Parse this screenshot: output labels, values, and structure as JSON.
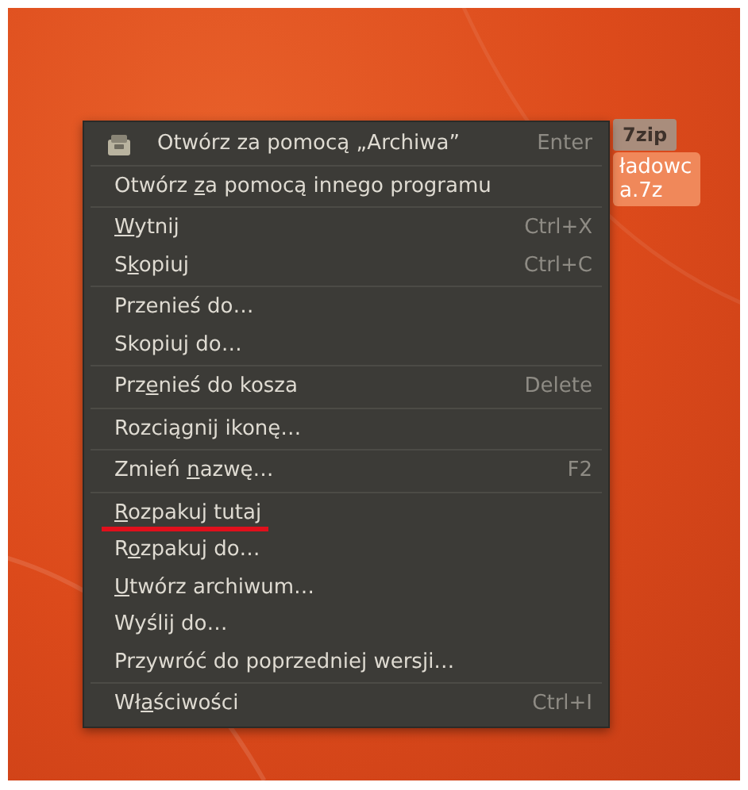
{
  "desktop_icon": {
    "icon_text": "7zip",
    "label_lines": [
      "ładowc",
      "a.7z"
    ],
    "selected": true
  },
  "menu": {
    "groups": [
      {
        "items": [
          {
            "kind": "app",
            "label_parts": [
              {
                "text": "Otwórz za pomocą „Archiwa”",
                "underlined": false
              }
            ],
            "shortcut": "Enter",
            "highlighted": false
          }
        ]
      },
      {
        "items": [
          {
            "kind": "plain",
            "label_parts": [
              {
                "text": "Otwórz ",
                "underlined": false
              },
              {
                "text": "z",
                "underlined": true
              },
              {
                "text": "a pomocą innego programu",
                "underlined": false
              }
            ],
            "highlighted": false
          }
        ]
      },
      {
        "items": [
          {
            "kind": "plain",
            "label_parts": [
              {
                "text": "W",
                "underlined": true
              },
              {
                "text": "ytnij",
                "underlined": false
              }
            ],
            "shortcut": "Ctrl+X",
            "highlighted": false
          },
          {
            "kind": "plain",
            "label_parts": [
              {
                "text": "S",
                "underlined": false
              },
              {
                "text": "k",
                "underlined": true
              },
              {
                "text": "opiuj",
                "underlined": false
              }
            ],
            "shortcut": "Ctrl+C",
            "highlighted": false
          }
        ]
      },
      {
        "items": [
          {
            "kind": "plain",
            "label_parts": [
              {
                "text": "Przenieś do…",
                "underlined": false
              }
            ],
            "highlighted": false
          },
          {
            "kind": "plain",
            "label_parts": [
              {
                "text": "Skopiuj do…",
                "underlined": false
              }
            ],
            "highlighted": false
          }
        ]
      },
      {
        "items": [
          {
            "kind": "plain",
            "label_parts": [
              {
                "text": "Prz",
                "underlined": false
              },
              {
                "text": "e",
                "underlined": true
              },
              {
                "text": "nieś do kosza",
                "underlined": false
              }
            ],
            "shortcut": "Delete",
            "highlighted": false
          }
        ]
      },
      {
        "items": [
          {
            "kind": "plain",
            "label_parts": [
              {
                "text": "Rozciągnij ikonę…",
                "underlined": false
              }
            ],
            "highlighted": false
          }
        ]
      },
      {
        "items": [
          {
            "kind": "plain",
            "label_parts": [
              {
                "text": "Zmień ",
                "underlined": false
              },
              {
                "text": "n",
                "underlined": true
              },
              {
                "text": "azwę…",
                "underlined": false
              }
            ],
            "shortcut": "F2",
            "highlighted": false
          }
        ]
      },
      {
        "items": [
          {
            "kind": "plain",
            "label_parts": [
              {
                "text": "R",
                "underlined": true
              },
              {
                "text": "ozpakuj tutaj",
                "underlined": false
              }
            ],
            "highlighted": true
          },
          {
            "kind": "plain",
            "label_parts": [
              {
                "text": "R",
                "underlined": false
              },
              {
                "text": "o",
                "underlined": true
              },
              {
                "text": "zpakuj do…",
                "underlined": false
              }
            ],
            "highlighted": false
          },
          {
            "kind": "plain",
            "label_parts": [
              {
                "text": "U",
                "underlined": true
              },
              {
                "text": "twórz archiwum…",
                "underlined": false
              }
            ],
            "highlighted": false
          },
          {
            "kind": "plain",
            "label_parts": [
              {
                "text": "Wyślij do…",
                "underlined": false
              }
            ],
            "highlighted": false
          },
          {
            "kind": "plain",
            "label_parts": [
              {
                "text": "Przywróć do poprzedniej wersji…",
                "underlined": false
              }
            ],
            "highlighted": false
          }
        ]
      },
      {
        "items": [
          {
            "kind": "plain",
            "label_parts": [
              {
                "text": "Wł",
                "underlined": false
              },
              {
                "text": "a",
                "underlined": true
              },
              {
                "text": "ściwości",
                "underlined": false
              }
            ],
            "shortcut": "Ctrl+I",
            "highlighted": false
          }
        ]
      }
    ]
  }
}
